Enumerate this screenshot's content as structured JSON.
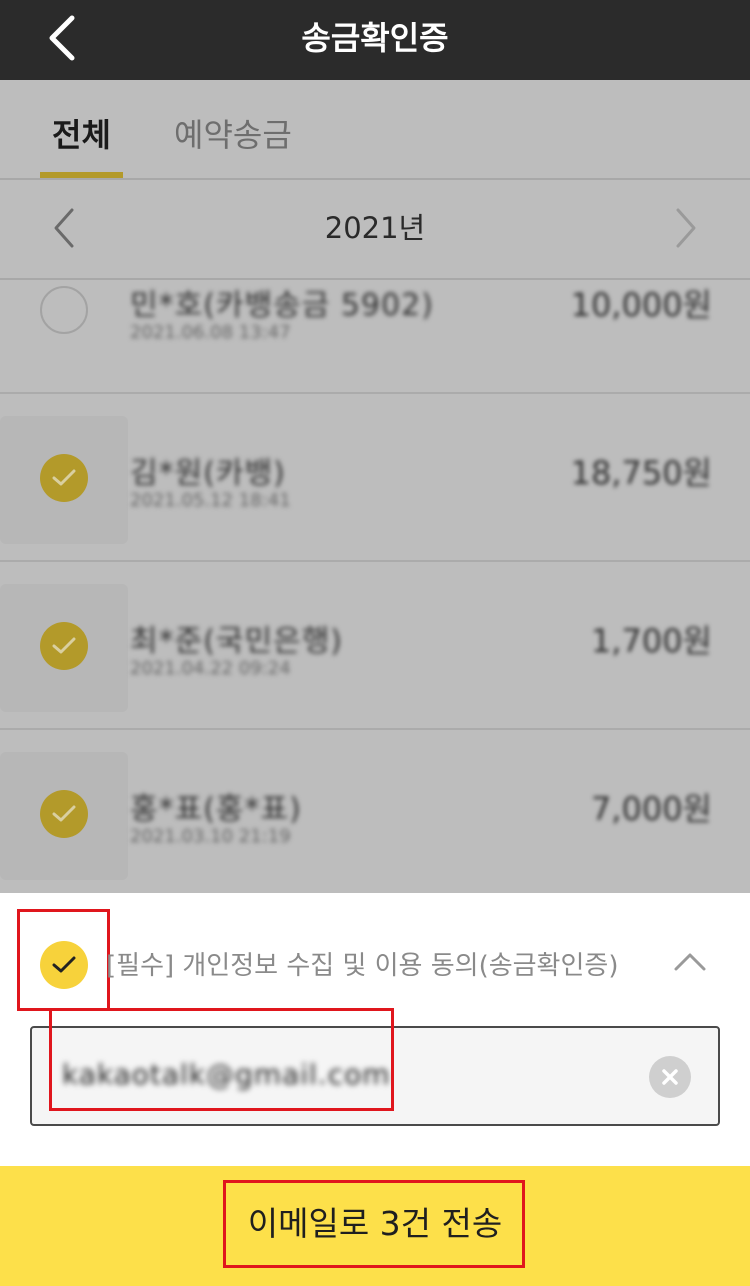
{
  "header": {
    "title": "송금확인증",
    "back_icon": "chevron-left-icon"
  },
  "tabs": [
    {
      "label": "전체",
      "active": true
    },
    {
      "label": "예약송금",
      "active": false
    }
  ],
  "year_nav": {
    "label": "2021년",
    "prev_icon": "chevron-left-icon",
    "next_icon": "chevron-right-icon"
  },
  "transactions": [
    {
      "name": "민*호(카뱅송금 5902)",
      "sub": "2021.06.08 13:47",
      "amount": "10,000원",
      "checked": false
    },
    {
      "name": "김*원(카뱅)",
      "sub": "2021.05.12 18:41",
      "amount": "18,750원",
      "checked": true
    },
    {
      "name": "최*준(국민은행)",
      "sub": "2021.04.22 09:24",
      "amount": "1,700원",
      "checked": true
    },
    {
      "name": "홍*표(홍*표)",
      "sub": "2021.03.10 21:19",
      "amount": "7,000원",
      "checked": true
    }
  ],
  "consent": {
    "label": "[필수] 개인정보 수집 및 이용 동의(송금확인증)",
    "checked": true
  },
  "email": {
    "value": "kakaotalk@gmail.com",
    "clear_icon": "clear-icon"
  },
  "send_button": {
    "label": "이메일로 3건 전송"
  },
  "colors": {
    "accent": "#fde04a",
    "check_on": "#f7d23b",
    "highlight": "#e0161d"
  }
}
